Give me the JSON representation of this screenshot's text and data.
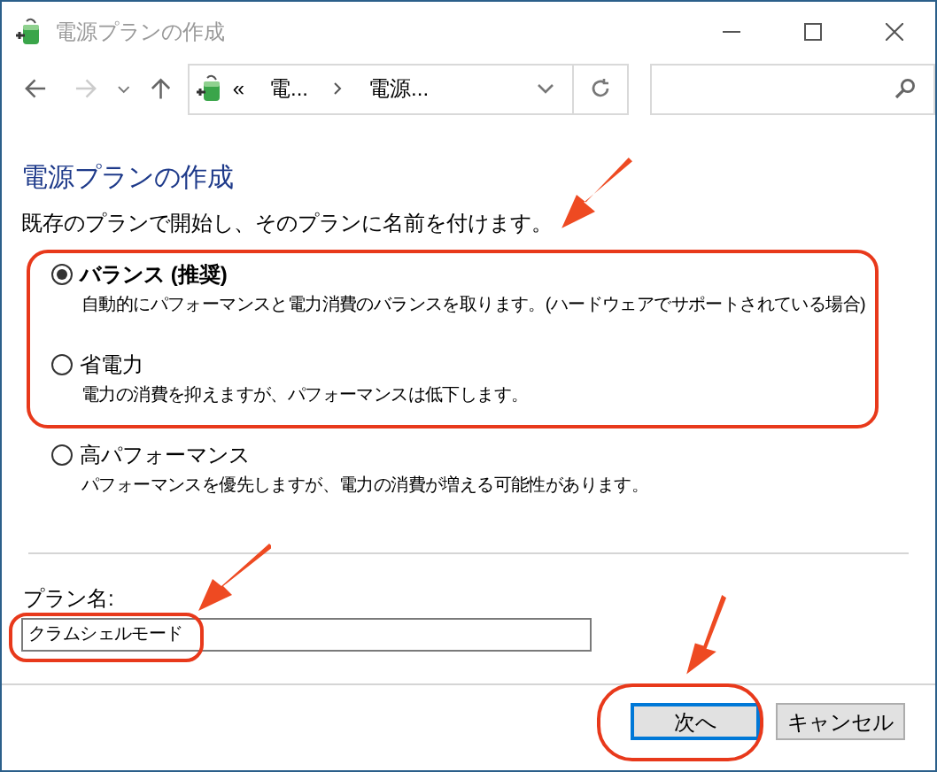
{
  "window": {
    "title": "電源プランの作成"
  },
  "address_bar": {
    "overflow": "«",
    "crumbs": [
      "電...",
      "電源..."
    ]
  },
  "heading": "電源プランの作成",
  "intro": "既存のプランで開始し、そのプランに名前を付けます。",
  "plans": [
    {
      "label": "バランス (推奨)",
      "description": "自動的にパフォーマンスと電力消費のバランスを取ります。(ハードウェアでサポートされている場合)",
      "selected": true
    },
    {
      "label": "省電力",
      "description": "電力の消費を抑えますが、パフォーマンスは低下します。",
      "selected": false
    },
    {
      "label": "高パフォーマンス",
      "description": "パフォーマンスを優先しますが、電力の消費が増える可能性があります。",
      "selected": false
    }
  ],
  "plan_name": {
    "label": "プラン名:",
    "value": "クラムシェルモード"
  },
  "buttons": [
    {
      "label": "次へ",
      "kind": "default"
    },
    {
      "label": "キャンセル",
      "kind": "normal"
    }
  ]
}
